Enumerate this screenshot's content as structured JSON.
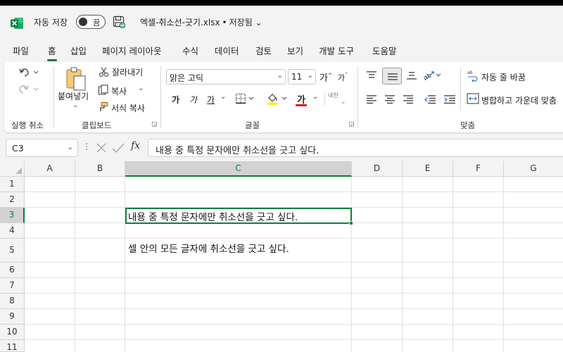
{
  "titlebar": {
    "autosave_label": "자동 저장",
    "autosave_state": "끔",
    "file_name": "엑셀-취소선-긋기.xlsx",
    "separator": "•",
    "save_status": "저장됨",
    "dropdown_arrow": "⌄",
    "accent": "#107c41"
  },
  "menu": {
    "items": [
      "파일",
      "홈",
      "삽입",
      "페이지 레이아웃",
      "수식",
      "데이터",
      "검토",
      "보기",
      "개발 도구",
      "도움말"
    ],
    "active": "홈"
  },
  "ribbon": {
    "undo_group": {
      "label": "실행 취소"
    },
    "clipboard": {
      "label": "클립보드",
      "paste": "붙여넣기",
      "cut": "잘라내기",
      "copy": "복사",
      "format_painter": "서식 복사"
    },
    "font": {
      "label": "글꼴",
      "font_name": "맑은 고딕",
      "font_size": "11",
      "grow": "가",
      "shrink": "가",
      "bold": "가",
      "italic": "가",
      "underline": "가",
      "font_color_glyph": "가",
      "phonetic": "내천",
      "font_color": "#e02020",
      "fill_color": "#ffee00"
    },
    "alignment": {
      "label": "맞춤",
      "wrap_text": "자동 줄 바꿈",
      "merge_center": "병합하고 가운데 맞춤"
    }
  },
  "formula_bar": {
    "name_box": "C3",
    "dots": "⋮",
    "fx": "fx",
    "content": "내용 중 특정 문자에만 취소선을 긋고 싶다."
  },
  "grid": {
    "columns": [
      "A",
      "B",
      "C",
      "D",
      "E",
      "F",
      "G"
    ],
    "rows": [
      "1",
      "2",
      "3",
      "4",
      "5",
      "6",
      "7",
      "8",
      "9",
      "10",
      "11"
    ],
    "selected_col": "C",
    "selected_row": "3",
    "cells": {
      "C3": "내용 중 특정 문자에만 취소선을 긋고 싶다.",
      "C5": "셀 안의 모든 글자에 취소선을 긋고 싶다."
    }
  }
}
